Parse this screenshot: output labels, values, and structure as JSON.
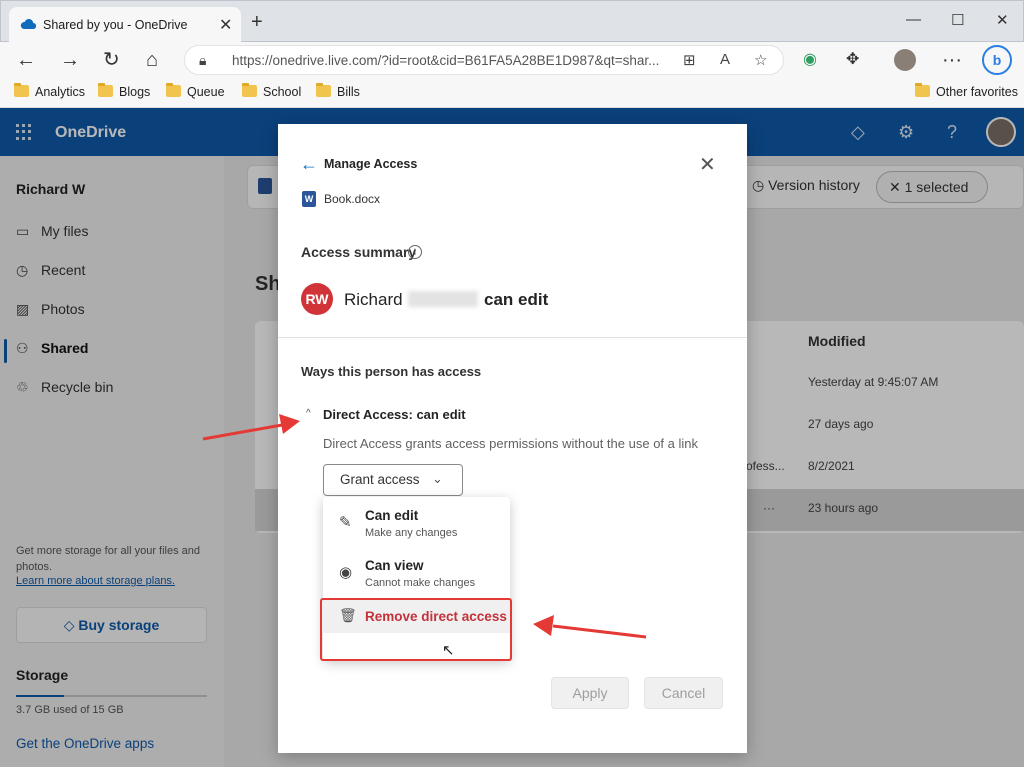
{
  "browser": {
    "tab_title": "Shared by you - OneDrive",
    "url": "https://onedrive.live.com/?id=root&cid=B61FA5A28BE1D987&qt=shar...",
    "favorites": [
      "Analytics",
      "Blogs",
      "Queue",
      "School",
      "Bills"
    ],
    "other_favorites": "Other favorites"
  },
  "app": {
    "title": "OneDrive"
  },
  "sidebar": {
    "user": "Richard W",
    "items": [
      {
        "label": "My files",
        "icon": "folder-icon"
      },
      {
        "label": "Recent",
        "icon": "clock-icon"
      },
      {
        "label": "Photos",
        "icon": "image-icon"
      },
      {
        "label": "Shared",
        "icon": "people-icon"
      },
      {
        "label": "Recycle bin",
        "icon": "recycle-bin-icon"
      }
    ],
    "promo_text": "Get more storage for all your files and photos.",
    "promo_link": "Learn more about storage plans.",
    "buy_storage": "Buy storage",
    "storage_heading": "Storage",
    "storage_used": "3.7 GB used of 15 GB",
    "storage_fraction": 0.25,
    "get_apps": "Get the OneDrive apps"
  },
  "commandbar": {
    "version_history": "Version history",
    "selected": "1 selected"
  },
  "list": {
    "section_title": "Sh",
    "modified_header": "Modified",
    "rows": [
      {
        "modified": "Yesterday at 9:45:07 AM",
        "extra": ""
      },
      {
        "modified": "27 days ago",
        "extra": ""
      },
      {
        "modified": "8/2/2021",
        "extra": "ofess..."
      },
      {
        "modified": "23 hours ago",
        "extra": "···"
      }
    ]
  },
  "dialog": {
    "title": "Manage Access",
    "file": "Book.docx",
    "access_summary": "Access summary",
    "avatar_initials": "RW",
    "person_first": "Richard",
    "can_edit": "can edit",
    "ways": "Ways this person has access",
    "direct_access": "Direct Access: can edit",
    "direct_desc": "Direct Access grants access permissions without the use of a link",
    "grant_access": "Grant access",
    "menu": [
      {
        "title": "Can edit",
        "subtitle": "Make any changes",
        "icon": "pencil-icon"
      },
      {
        "title": "Can view",
        "subtitle": "Cannot make changes",
        "icon": "eye-icon"
      }
    ],
    "remove": "Remove direct access",
    "apply": "Apply",
    "cancel": "Cancel"
  },
  "colors": {
    "header": "#0f5aab",
    "accent": "#0f6cbd",
    "annotation_red": "#e53935",
    "remove_text": "#c4313b",
    "avatar": "#d13438"
  }
}
